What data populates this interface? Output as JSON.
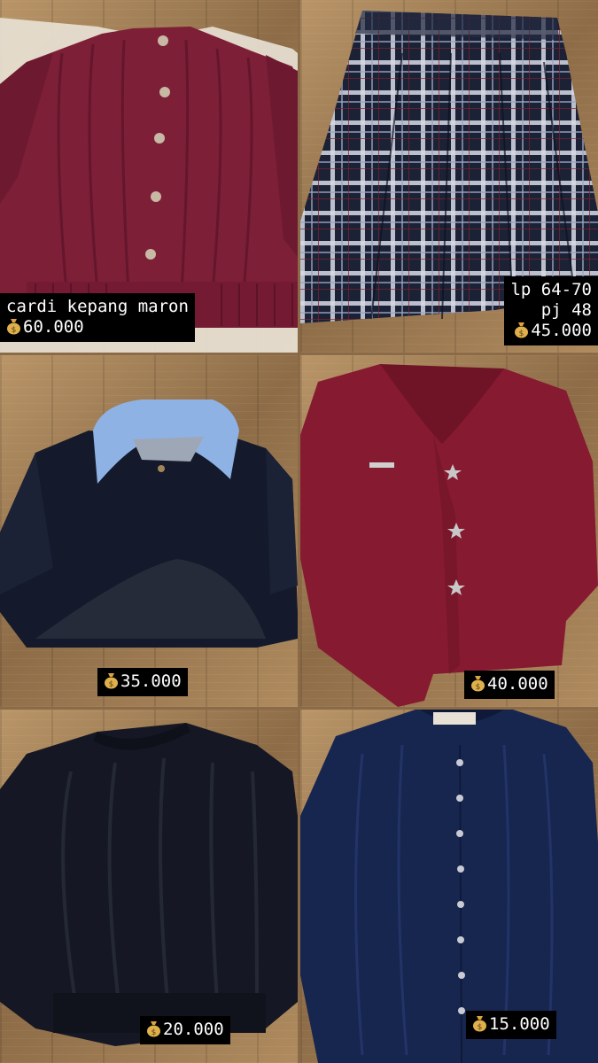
{
  "items": [
    {
      "name": "cardi kepang maron",
      "price": "60.000",
      "icon": "money-bag-icon",
      "color": "#7d1f37"
    },
    {
      "detail_1": "lp 64-70",
      "detail_2": "pj 48",
      "price": "45.000",
      "icon": "money-bag-icon",
      "color": "#1c2236"
    },
    {
      "price": "35.000",
      "icon": "money-bag-icon",
      "color": "#141a2b",
      "collar_color": "#8fb2e5"
    },
    {
      "price": "40.000",
      "icon": "money-bag-icon",
      "color": "#861a30"
    },
    {
      "price": "20.000",
      "icon": "money-bag-icon",
      "color": "#151824"
    },
    {
      "price": "15.000",
      "icon": "money-bag-icon",
      "color": "#17264f"
    }
  ]
}
